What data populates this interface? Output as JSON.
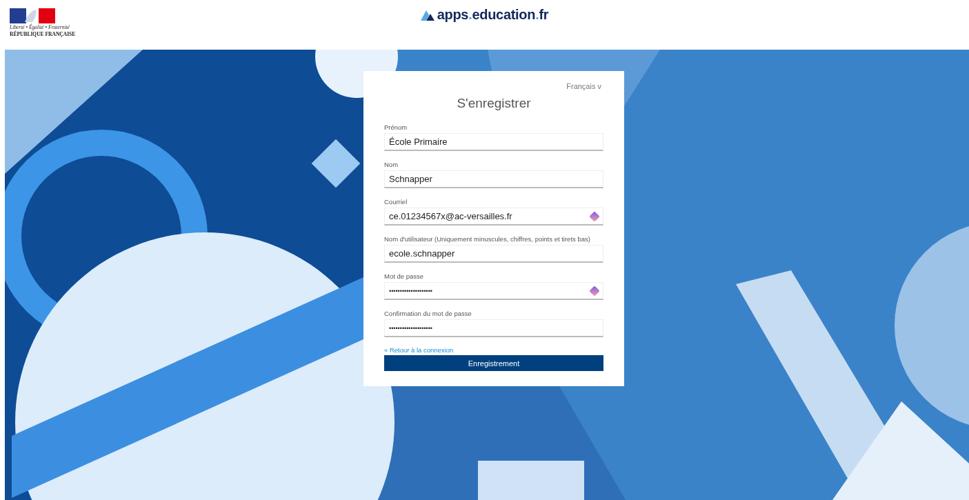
{
  "header": {
    "emblem": {
      "motto": "Liberté • Égalité • Fraternité",
      "name": "RÉPUBLIQUE FRANÇAISE"
    },
    "brand": {
      "parts": [
        "apps",
        "education",
        "fr"
      ],
      "separator": "."
    }
  },
  "form": {
    "language": "Français",
    "language_caret": "v",
    "title": "S'enregistrer",
    "fields": [
      {
        "label": "Prénom",
        "value": "École Primaire",
        "kind": "text",
        "manager_icon": false
      },
      {
        "label": "Nom",
        "value": "Schnapper",
        "kind": "text",
        "manager_icon": false
      },
      {
        "label": "Courriel",
        "value": "ce.01234567x@ac-versailles.fr",
        "kind": "text",
        "manager_icon": true
      },
      {
        "label": "Nom d'utilisateur (Uniquement minuscules, chiffres, points et tirets bas)",
        "value": "ecole.schnapper",
        "kind": "text",
        "manager_icon": false
      },
      {
        "label": "Mot de passe",
        "value": "••••••••••••••••••••",
        "kind": "password",
        "manager_icon": true
      },
      {
        "label": "Confirmation du mot de passe",
        "value": "••••••••••••••••••••",
        "kind": "password",
        "manager_icon": false
      }
    ],
    "back_link": "« Retour à la connexion",
    "submit": "Enregistrement"
  }
}
